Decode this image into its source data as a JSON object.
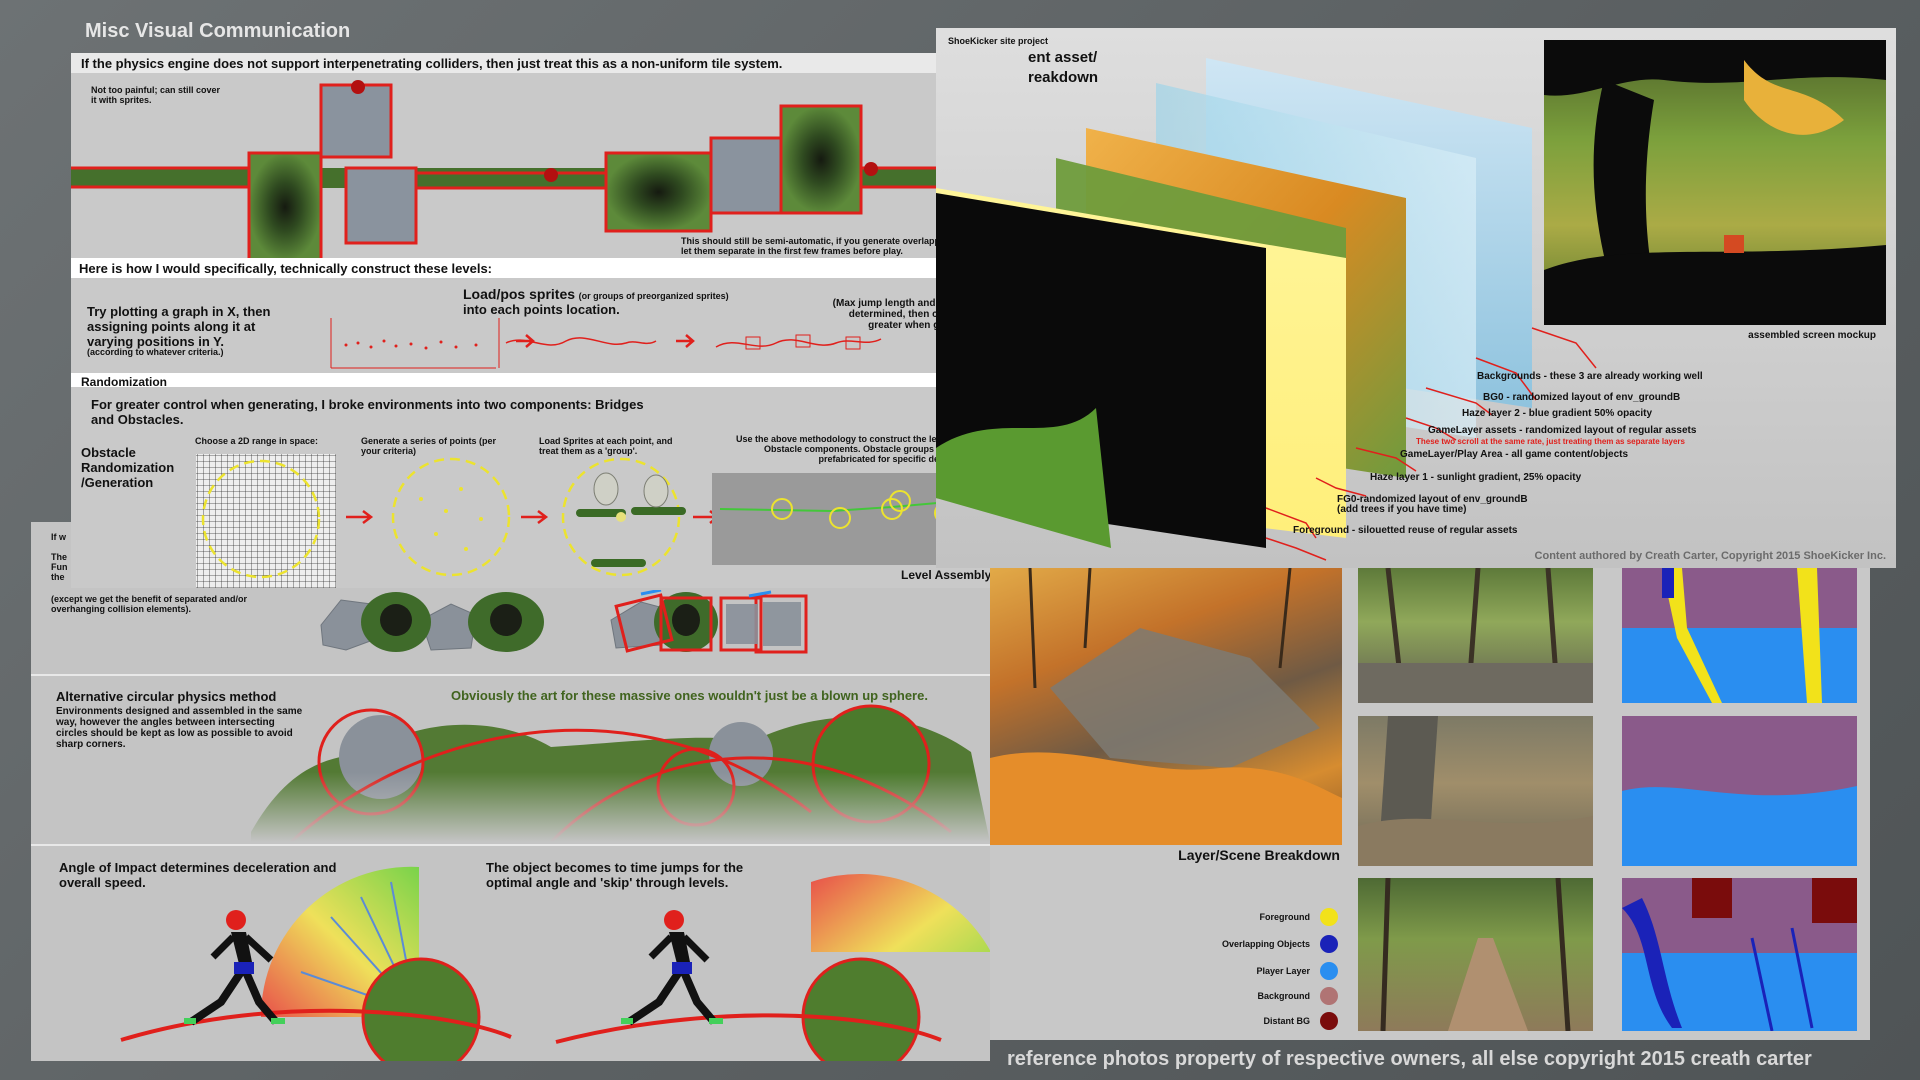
{
  "page": {
    "title": "Misc Visual Communication",
    "footer": "reference photos property of respective owners, all else copyright 2015 creath carter"
  },
  "tiles": {
    "heading": "If the physics engine does not support interpenetrating colliders, then just treat this as a non-uniform tile system.",
    "note_left": "Not too painful; can still cover it with sprites.",
    "note_right": "This should still be semi-automatic, if you generate overlapping colliders and let them separate in the first few frames before play."
  },
  "construct": {
    "heading": "Here is how I would specifically, technically construct these levels:",
    "step1": "Try plotting a graph in X, then assigning points along it at varying positions in Y.",
    "step1_note": "(according to whatever criteria.)",
    "step2_title": "Load/pos sprites",
    "step2_sub": "(or groups of preorganized sprites)",
    "step2_tail": "into each points location.",
    "step3": "(Max jump length and height need to be determined, then check for anything greater when generating a level)"
  },
  "randomization": {
    "heading": "Randomization",
    "intro": "For greater control when generating, I broke environments into two components: Bridges and Obstacles.",
    "side_label": "Obstacle Randomization /Generation",
    "col1": "Choose a 2D range in space:",
    "col2": "Generate a series of points (per your criteria)",
    "col3": "Load Sprites at each point, and treat them as a 'group'.",
    "col4": "Use the above methodology to construct the level from Bridge and Obstacle components.  Obstacle groups could potentially be prefabricated for specific design combinations.",
    "assembly_label": "Level Assembly"
  },
  "back_panel": {
    "hidden_1": "If w",
    "hidden_2": "The",
    "hidden_3": "Fun",
    "hidden_4": "the",
    "note": "(except we get the benefit of separated and/or overhanging collision elements)."
  },
  "circular": {
    "heading": "Alternative circular physics method",
    "body": "Environments designed and assembled in the same way, however the angles between intersecting circles should be kept as low as possible to avoid sharp corners.",
    "green_note": "Obviously the art for these massive ones wouldn't just be a blown up sphere."
  },
  "impact": {
    "left": "Angle of Impact determines deceleration and overall speed.",
    "right": "The object becomes to time jumps for the optimal angle and 'skip' through levels."
  },
  "layers": {
    "project_tag": "ShoeKicker site project",
    "title_line1": "ent asset/",
    "title_line2": "reakdown",
    "mockup_caption": "assembled screen mockup",
    "labels": [
      "Backgrounds - these 3 are already working well",
      "BG0 - randomized layout of env_groundB",
      "Haze layer 2 - blue gradient 50% opacity",
      "GameLayer assets - randomized layout of regular assets",
      "These two scroll at the same rate, just treating them as separate layers",
      "GameLayer/Play Area - all game content/objects",
      "Haze layer 1 - sunlight gradient, 25% opacity",
      "FG0-randomized layout of env_groundB",
      "(add trees if you have time)",
      "Foreground - silouetted reuse of regular assets"
    ],
    "credit": "Content authored by Creath Carter, Copyright 2015 ShoeKicker Inc."
  },
  "reference": {
    "caption": "Layer/Scene Breakdown",
    "legend": [
      {
        "label": "Foreground",
        "color": "#f2e21a"
      },
      {
        "label": "Overlapping Objects",
        "color": "#1a22b8"
      },
      {
        "label": "Player Layer",
        "color": "#2a8ef0"
      },
      {
        "label": "Background",
        "color": "#b07474"
      },
      {
        "label": "Distant BG",
        "color": "#7a0c0c"
      }
    ]
  },
  "colors": {
    "accent_red": "#e0201c",
    "green": "#5aa832",
    "yellow": "#f2e21a"
  }
}
